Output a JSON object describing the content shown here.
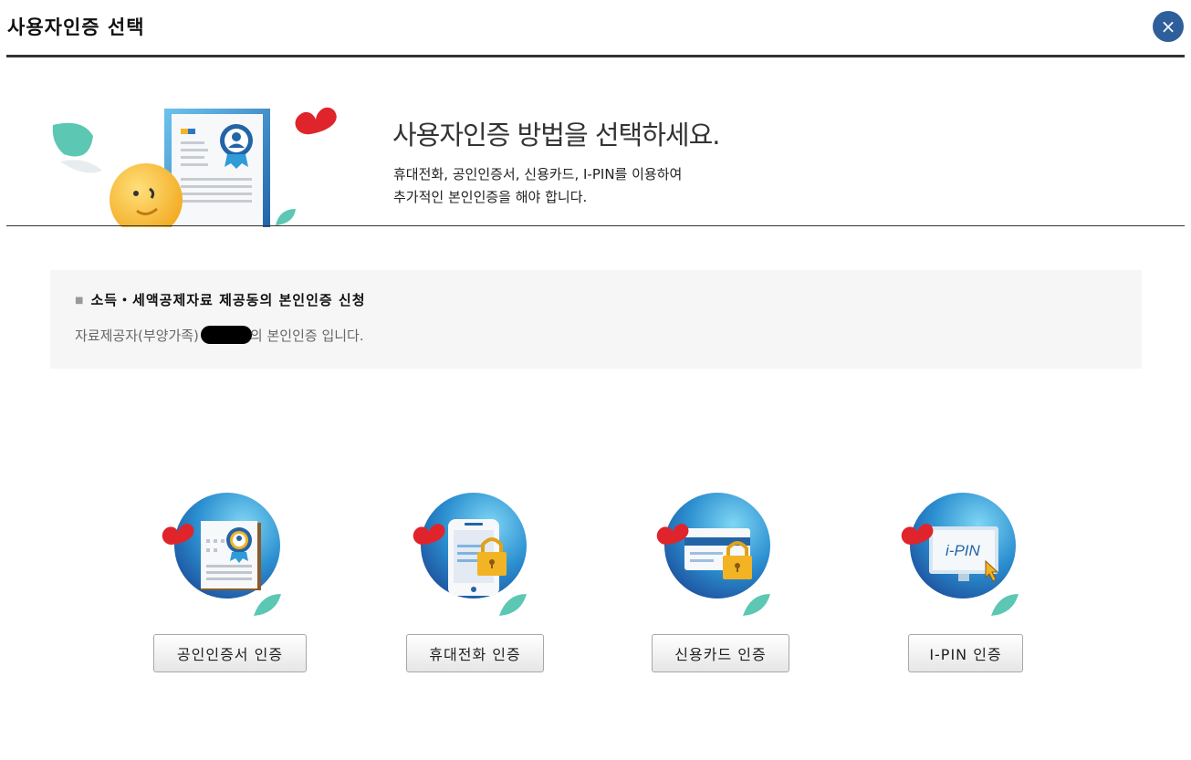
{
  "header": {
    "title": "사용자인증 선택",
    "close_glyph": "×"
  },
  "banner": {
    "heading": "사용자인증 방법을 선택하세요.",
    "desc_line1": "휴대전화, 공인인증서, 신용카드, I-PIN를 이용하여",
    "desc_line2": "추가적인 본인인증을 해야 합니다."
  },
  "info": {
    "title": "소득・세액공제자료 제공동의 본인인증 신청",
    "desc_prefix": "자료제공자(부양가족)",
    "desc_suffix": "의 본인인증 입니다."
  },
  "methods": [
    {
      "label": "공인인증서 인증",
      "icon": "certificate-icon"
    },
    {
      "label": "휴대전화 인증",
      "icon": "phone-lock-icon"
    },
    {
      "label": "신용카드 인증",
      "icon": "credit-card-lock-icon"
    },
    {
      "label": "I-PIN 인증",
      "icon": "ipin-monitor-icon",
      "icon_text": "i-PIN"
    }
  ],
  "colors": {
    "accent": "#2f5f9b",
    "circle_blue": "#1f7fc4",
    "heart_red": "#e0242c",
    "leaf_teal": "#5cc7b2"
  }
}
